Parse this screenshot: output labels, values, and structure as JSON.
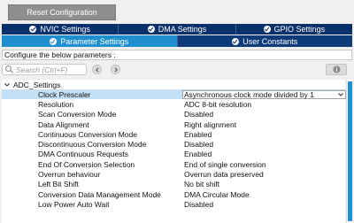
{
  "toolbar": {
    "reset_label": "Reset Configuration"
  },
  "tabs_row1": [
    {
      "label": "NVIC Settings"
    },
    {
      "label": "DMA Settings"
    },
    {
      "label": "GPIO Settings"
    }
  ],
  "tabs_row2": [
    {
      "label": "Parameter Settings",
      "active": true
    },
    {
      "label": "User Constants",
      "active": false
    }
  ],
  "configure_text": "Configure the below parameters :",
  "search": {
    "placeholder": "Search (Ctrl+F)"
  },
  "group": {
    "label": "ADC_Settings"
  },
  "params": [
    {
      "name": "Clock Prescaler",
      "value": "Asynchronous clock mode divided by 1"
    },
    {
      "name": "Resolution",
      "value": "ADC 8-bit resolution"
    },
    {
      "name": "Scan Conversion Mode",
      "value": "Disabled"
    },
    {
      "name": "Data Alignment",
      "value": "Right alignment"
    },
    {
      "name": "Continuous Conversion Mode",
      "value": "Enabled"
    },
    {
      "name": "Discontinuous Conversion Mode",
      "value": "Disabled"
    },
    {
      "name": "DMA Continuous Requests",
      "value": "Enabled"
    },
    {
      "name": "End Of Conversion Selection",
      "value": "End of single conversion"
    },
    {
      "name": "Overrun behaviour",
      "value": "Overrun data preserved"
    },
    {
      "name": "Left Bit Shift",
      "value": "No bit shift"
    },
    {
      "name": "Conversion Data Management Mode",
      "value": "DMA Circular Mode"
    },
    {
      "name": "Low Power Auto Wait",
      "value": "Disabled"
    }
  ],
  "colors": {
    "tab_bar": "#08306a",
    "tab_active": "#1f8fcf",
    "selected_row": "#c4e0f6",
    "scroll_thumb": "#1f8fcf"
  },
  "icons": [
    "check-icon",
    "search-icon",
    "prev-icon",
    "next-icon",
    "info-icon",
    "collapse-icon",
    "chevron-down-icon"
  ]
}
